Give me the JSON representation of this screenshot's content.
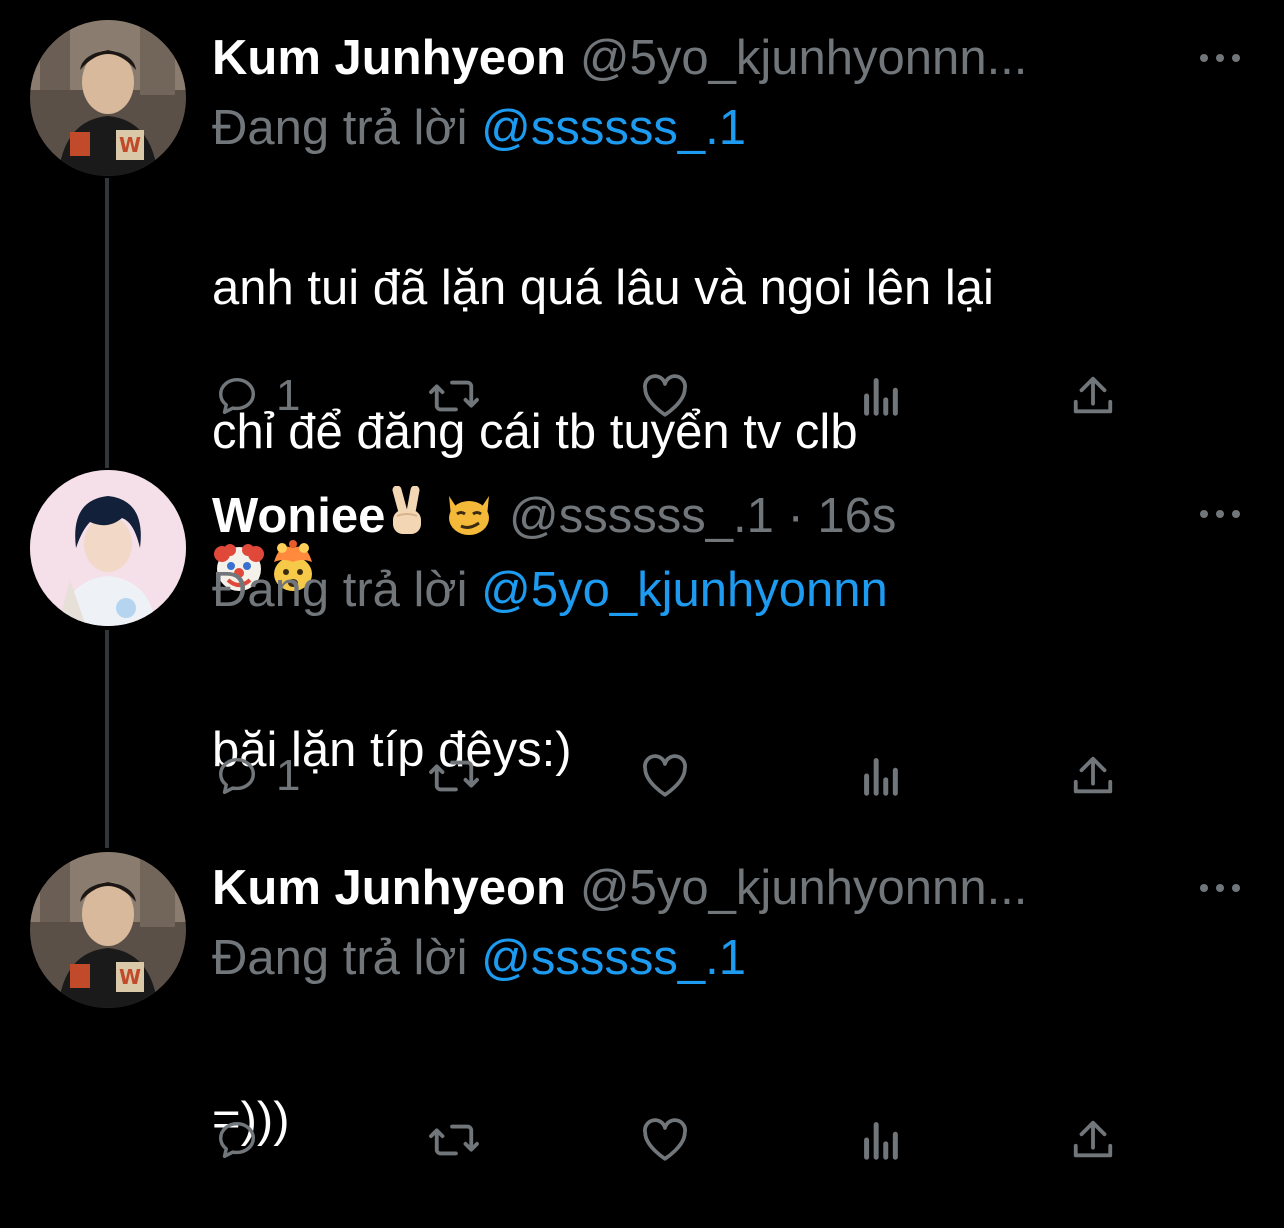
{
  "theme": {
    "background": "#000000",
    "text_primary": "#ffffff",
    "text_secondary": "#71767b",
    "accent": "#1d9bf0",
    "thread_line": "#333639"
  },
  "tweets": [
    {
      "display_name": "Kum Junhyeon",
      "handle": "@5yo_kjunhyonnn...",
      "reply_prefix": "Đang trả lời",
      "reply_to": "@ssssss_.1",
      "text_line1": "anh tui đã lặn quá lâu và ngoi lên lại",
      "text_line2": "chỉ để đăng cái tb tuyển tv clb",
      "emojis": [
        "clown-face-emoji",
        "exploding-head-emoji"
      ],
      "reply_count": "1"
    },
    {
      "display_name": "Woniee",
      "name_emojis": [
        "victory-hand-emoji",
        "smirking-cat-emoji"
      ],
      "handle": "@ssssss_.1 · 16s",
      "reply_prefix": "Đang trả lời",
      "reply_to": "@5yo_kjunhyonnn",
      "text_line1": "băi lặn típ đêys:)",
      "reply_count": "1"
    },
    {
      "display_name": "Kum Junhyeon",
      "handle": "@5yo_kjunhyonnn...",
      "reply_prefix": "Đang trả lời",
      "reply_to": "@ssssss_.1",
      "text_line1": "=)))",
      "reply_count": ""
    }
  ],
  "icons": {
    "reply": "reply-bubble-icon",
    "retweet": "retweet-icon",
    "like": "heart-icon",
    "views": "views-bar-chart-icon",
    "share": "share-upload-icon",
    "more": "more-dots-icon"
  }
}
